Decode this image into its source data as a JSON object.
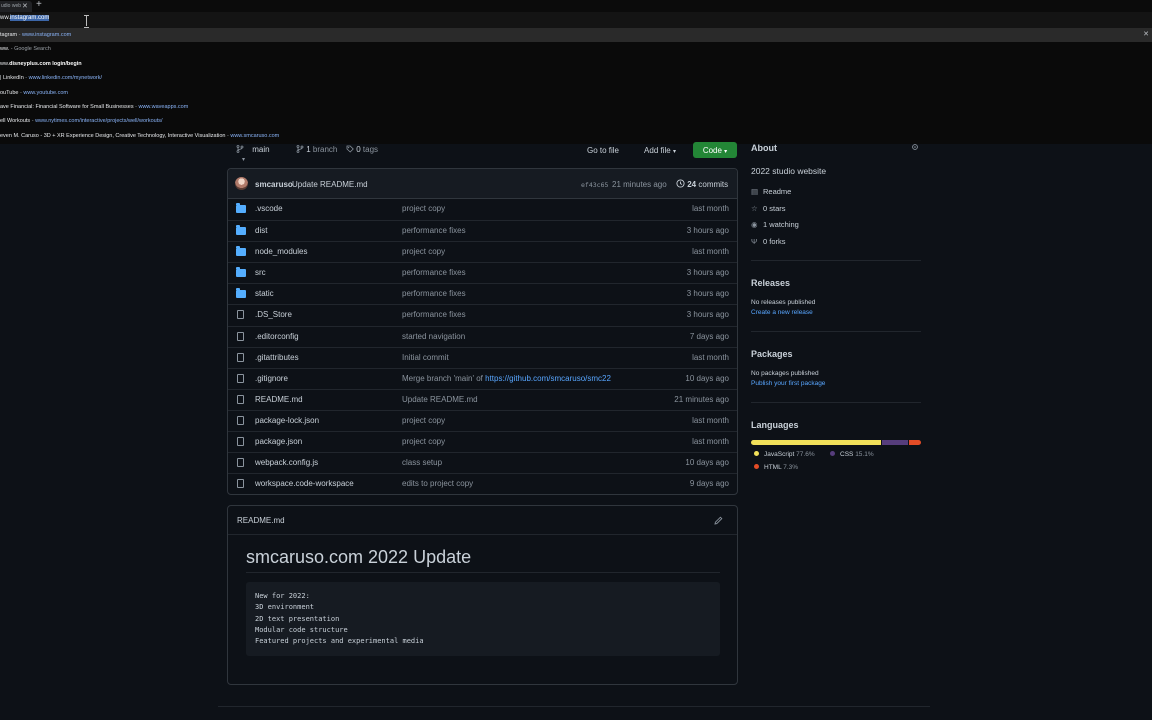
{
  "browser": {
    "tab_title": "udio web",
    "tab_close": "✕",
    "new_tab": "+",
    "omnibox_prefix": "ww.",
    "omnibox_selected": "instagram.com",
    "suggestions": [
      {
        "title": "tagram",
        "sep": " - ",
        "url": "www.instagram.com",
        "style": "link"
      },
      {
        "title": "ww.",
        "sep": " - ",
        "url": "Google Search",
        "style": "search"
      },
      {
        "title": "ww.",
        "bold": "disneyplus.com login/begin",
        "sep": "",
        "url": "",
        "style": "bold"
      },
      {
        "title": "| LinkedIn",
        "sep": " - ",
        "url": "www.linkedin.com/mynetwork/",
        "style": "link"
      },
      {
        "title": "ouTube",
        "sep": " - ",
        "url": "www.youtube.com",
        "style": "link"
      },
      {
        "title": "ave Financial: Financial Software for Small Businesses",
        "sep": " - ",
        "url": "www.waveapps.com",
        "style": "link"
      },
      {
        "title": "ell Workouts",
        "sep": " - ",
        "url": "www.nytimes.com/interactive/projects/well/workouts/",
        "style": "link"
      },
      {
        "title": "even M. Caruso - 3D + XR Experience Design, Creative Technology, Interactive Visualization",
        "sep": " - ",
        "url": "www.smcaruso.com",
        "style": "link"
      }
    ],
    "dismiss": "✕"
  },
  "repo": {
    "branch": "main",
    "branch_count": "1",
    "branch_label": "branch",
    "tag_count": "0",
    "tag_label": "tags",
    "go_to_file": "Go to file",
    "add_file": "Add file",
    "code": "Code",
    "latest_commit": {
      "author": "smcaruso",
      "message": "Update README.md",
      "sha": "ef43c65",
      "time": "21 minutes ago",
      "count": "24",
      "count_label": "commits"
    },
    "files": [
      {
        "type": "dir",
        "name": ".vscode",
        "message": "project copy",
        "time": "last month"
      },
      {
        "type": "dir",
        "name": "dist",
        "message": "performance fixes",
        "time": "3 hours ago"
      },
      {
        "type": "dir",
        "name": "node_modules",
        "message": "project copy",
        "time": "last month"
      },
      {
        "type": "dir",
        "name": "src",
        "message": "performance fixes",
        "time": "3 hours ago"
      },
      {
        "type": "dir",
        "name": "static",
        "message": "performance fixes",
        "time": "3 hours ago"
      },
      {
        "type": "file",
        "name": ".DS_Store",
        "message": "performance fixes",
        "time": "3 hours ago"
      },
      {
        "type": "file",
        "name": ".editorconfig",
        "message": "started navigation",
        "time": "7 days ago"
      },
      {
        "type": "file",
        "name": ".gitattributes",
        "message": "Initial commit",
        "time": "last month"
      },
      {
        "type": "file",
        "name": ".gitignore",
        "message": "Merge branch 'main' of ",
        "link": "https://github.com/smcaruso/smc22",
        "time": "10 days ago"
      },
      {
        "type": "file",
        "name": "README.md",
        "message": "Update README.md",
        "time": "21 minutes ago"
      },
      {
        "type": "file",
        "name": "package-lock.json",
        "message": "project copy",
        "time": "last month"
      },
      {
        "type": "file",
        "name": "package.json",
        "message": "project copy",
        "time": "last month"
      },
      {
        "type": "file",
        "name": "webpack.config.js",
        "message": "class setup",
        "time": "10 days ago"
      },
      {
        "type": "file",
        "name": "workspace.code-workspace",
        "message": "edits to project copy",
        "time": "9 days ago"
      }
    ]
  },
  "readme": {
    "filename": "README.md",
    "heading": "smcaruso.com 2022 Update",
    "code_lines": [
      "New for 2022:",
      "3D environment",
      "2D text presentation",
      "Modular code structure",
      "Featured projects and experimental media"
    ]
  },
  "sidebar": {
    "about_heading": "About",
    "description": "2022 studio website",
    "readme": "Readme",
    "stars": "0 stars",
    "watching": "1 watching",
    "forks": "0 forks",
    "releases_heading": "Releases",
    "releases_note": "No releases published",
    "releases_link": "Create a new release",
    "packages_heading": "Packages",
    "packages_note": "No packages published",
    "packages_link": "Publish your first package",
    "languages_heading": "Languages",
    "languages": [
      {
        "name": "JavaScript",
        "percent": "77.6%",
        "value": 77.6,
        "color": "#f1e05a"
      },
      {
        "name": "CSS",
        "percent": "15.1%",
        "value": 15.1,
        "color": "#563d7c"
      },
      {
        "name": "HTML",
        "percent": "7.3%",
        "value": 7.3,
        "color": "#e34c26"
      }
    ]
  }
}
